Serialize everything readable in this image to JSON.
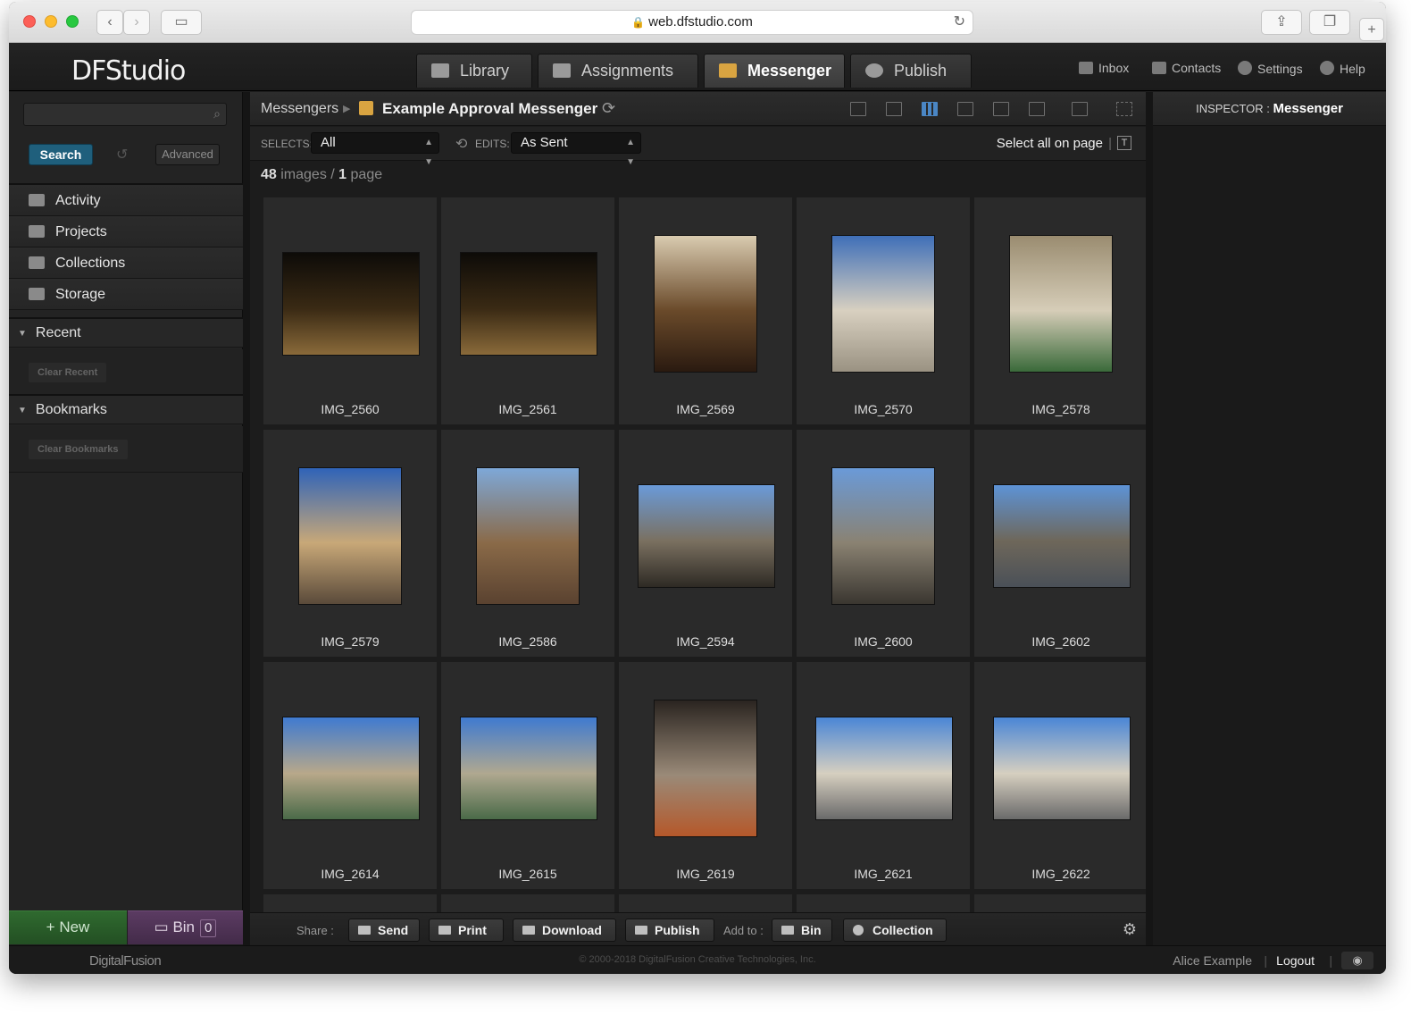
{
  "browser": {
    "url": "web.dfstudio.com"
  },
  "app": {
    "logo": "DFStudio",
    "tabs": [
      {
        "label": "Library",
        "active": false
      },
      {
        "label": "Assignments",
        "active": false
      },
      {
        "label": "Messenger",
        "active": true
      },
      {
        "label": "Publish",
        "active": false
      }
    ],
    "header_links": [
      "Inbox",
      "Contacts",
      "Settings",
      "Help"
    ]
  },
  "sidebar": {
    "search_placeholder": "",
    "search_label": "Search",
    "advanced_label": "Advanced",
    "nav": [
      {
        "label": "Activity",
        "icon": "bar-chart-icon"
      },
      {
        "label": "Projects",
        "icon": "layers-icon"
      },
      {
        "label": "Collections",
        "icon": "stack-icon"
      },
      {
        "label": "Storage",
        "icon": "storage-icon"
      }
    ],
    "recent": {
      "title": "Recent",
      "clear_label": "Clear Recent"
    },
    "bookmarks": {
      "title": "Bookmarks",
      "clear_label": "Clear Bookmarks"
    },
    "new_label": "New",
    "bin_label": "Bin",
    "bin_count": "0"
  },
  "main": {
    "breadcrumb_root": "Messengers",
    "title": "Example Approval Messenger",
    "selects_label": "SELECTS:",
    "selects_value": "All",
    "edits_label": "EDITS:",
    "edits_value": "As Sent",
    "select_all_label": "Select all on page",
    "image_count": "48",
    "images_word": "images",
    "page_count": "1",
    "page_word": "page",
    "images": [
      {
        "name": "IMG_2560",
        "orient": "land",
        "colors": [
          "#0d0b08",
          "#3a2a14",
          "#8a6a3a"
        ]
      },
      {
        "name": "IMG_2561",
        "orient": "land",
        "colors": [
          "#0d0b08",
          "#3a2a14",
          "#8a6a3a"
        ]
      },
      {
        "name": "IMG_2569",
        "orient": "port",
        "colors": [
          "#d9cbb0",
          "#6a4a2a",
          "#2a1a10"
        ]
      },
      {
        "name": "IMG_2570",
        "orient": "port",
        "colors": [
          "#3f6fb8",
          "#d8d0c0",
          "#9a9282"
        ]
      },
      {
        "name": "IMG_2578",
        "orient": "port",
        "colors": [
          "#9a8c70",
          "#d6cdb8",
          "#3a6a3a"
        ]
      },
      {
        "name": "IMG_2579",
        "orient": "port",
        "colors": [
          "#2f63b8",
          "#c8a878",
          "#5a4a3a"
        ]
      },
      {
        "name": "IMG_2586",
        "orient": "port",
        "colors": [
          "#7ea8d8",
          "#8a6a48",
          "#5a4230"
        ]
      },
      {
        "name": "IMG_2594",
        "orient": "land",
        "colors": [
          "#6a9ad8",
          "#7a7060",
          "#2e2a24"
        ]
      },
      {
        "name": "IMG_2600",
        "orient": "port",
        "colors": [
          "#6a9ad8",
          "#8a8272",
          "#3a3630"
        ]
      },
      {
        "name": "IMG_2602",
        "orient": "land",
        "colors": [
          "#5d93d6",
          "#6e675a",
          "#4a5058"
        ]
      },
      {
        "name": "IMG_2614",
        "orient": "land",
        "colors": [
          "#3f7ad0",
          "#b8a88a",
          "#4a6a48"
        ]
      },
      {
        "name": "IMG_2615",
        "orient": "land",
        "colors": [
          "#3f7ad0",
          "#b0a890",
          "#4a6a48"
        ]
      },
      {
        "name": "IMG_2619",
        "orient": "port",
        "colors": [
          "#2a2420",
          "#9a8a78",
          "#b5582a"
        ]
      },
      {
        "name": "IMG_2621",
        "orient": "land",
        "colors": [
          "#4a86d6",
          "#d6cfc0",
          "#6a6a6a"
        ]
      },
      {
        "name": "IMG_2622",
        "orient": "land",
        "colors": [
          "#4a86d6",
          "#d6cfc0",
          "#6a6a6a"
        ]
      }
    ]
  },
  "actions": {
    "share_label": "Share :",
    "send": "Send",
    "print": "Print",
    "download": "Download",
    "publish": "Publish",
    "add_to_label": "Add to :",
    "bin": "Bin",
    "collection": "Collection"
  },
  "inspector": {
    "prefix": "INSPECTOR :",
    "title": "Messenger"
  },
  "footer": {
    "logo": "DigitalFusion",
    "copyright": "© 2000-2018 DigitalFusion Creative Technologies, Inc.",
    "user": "Alice Example",
    "logout": "Logout"
  }
}
